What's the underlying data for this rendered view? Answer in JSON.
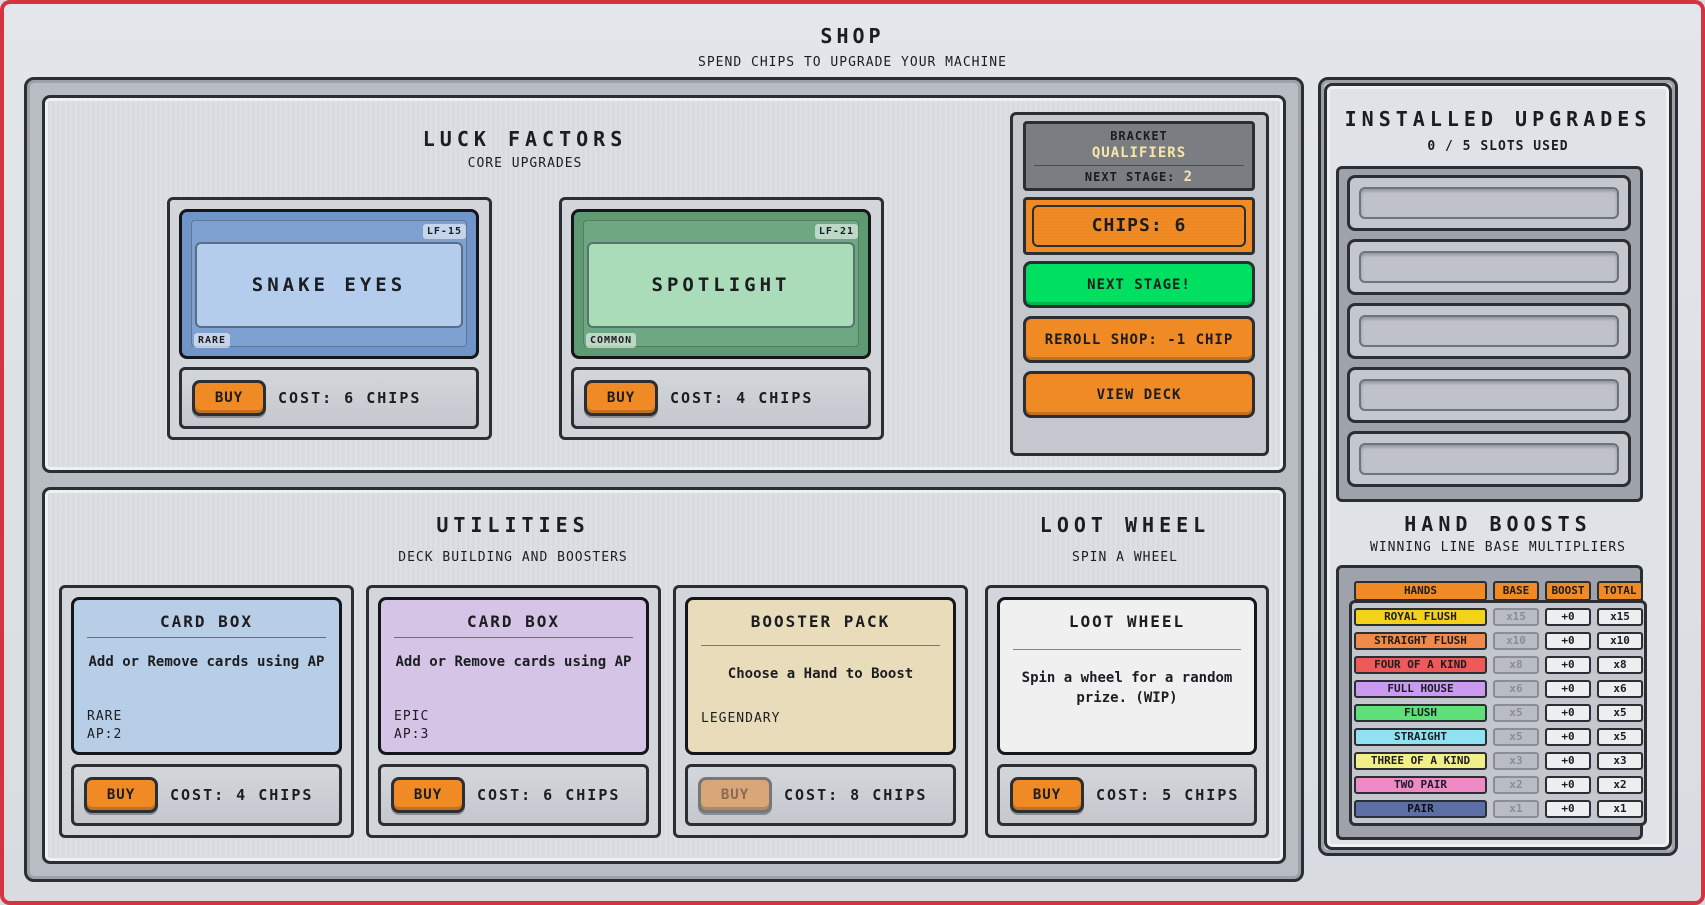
{
  "shop": {
    "title": "SHOP",
    "subtitle": "SPEND CHIPS TO UPGRADE YOUR MACHINE"
  },
  "luck_factors": {
    "title": "LUCK FACTORS",
    "subtitle": "CORE UPGRADES",
    "cards": [
      {
        "name": "SNAKE EYES",
        "code": "LF-15",
        "rarity": "RARE",
        "buy_label": "BUY",
        "cost": "COST: 6 CHIPS",
        "color": "#6f95c9"
      },
      {
        "name": "SPOTLIGHT",
        "code": "LF-21",
        "rarity": "COMMON",
        "buy_label": "BUY",
        "cost": "COST: 4 CHIPS",
        "color": "#5f9a73"
      }
    ]
  },
  "controls": {
    "bracket_label": "BRACKET",
    "bracket_value": "QUALIFIERS",
    "next_stage_label": "NEXT STAGE:",
    "next_stage_value": "2",
    "chips": "CHIPS: 6",
    "next_stage_button": "NEXT STAGE!",
    "reroll_button": "REROLL SHOP: -1 CHIP",
    "view_deck_button": "VIEW DECK",
    "colors": {
      "accent": "#f08a24",
      "go": "#00e060"
    }
  },
  "utilities": {
    "title": "UTILITIES",
    "subtitle": "DECK BUILDING AND BOOSTERS",
    "cards": [
      {
        "title": "CARD BOX",
        "desc": "Add or Remove cards using AP",
        "rarity": "RARE",
        "ap": "AP:2",
        "buy_label": "BUY",
        "cost": "COST: 4 CHIPS",
        "color": "#b8cde6"
      },
      {
        "title": "CARD BOX",
        "desc": "Add or Remove cards using AP",
        "rarity": "EPIC",
        "ap": "AP:3",
        "buy_label": "BUY",
        "cost": "COST: 6 CHIPS",
        "color": "#d5c4e6"
      },
      {
        "title": "BOOSTER PACK",
        "desc": "Choose a Hand to Boost",
        "rarity": "LEGENDARY",
        "buy_label": "BUY",
        "cost": "COST: 8 CHIPS",
        "color": "#e8dcba"
      }
    ]
  },
  "loot_wheel": {
    "title": "LOOT WHEEL",
    "subtitle": "SPIN A WHEEL",
    "card": {
      "title": "LOOT WHEEL",
      "desc": "Spin a wheel for a random prize. (WIP)",
      "buy_label": "BUY",
      "cost": "COST: 5 CHIPS",
      "color": "#f0f0f0"
    }
  },
  "installed": {
    "title": "INSTALLED UPGRADES",
    "slots_used": "0 / 5 SLOTS USED"
  },
  "hand_boosts": {
    "title": "HAND BOOSTS",
    "subtitle": "WINNING LINE BASE MULTIPLIERS",
    "headers": [
      "HANDS",
      "BASE",
      "BOOST",
      "TOTAL"
    ],
    "rows": [
      {
        "hand": "ROYAL FLUSH",
        "base": "x15",
        "boost": "+0",
        "total": "x15",
        "color": "#f4d21a"
      },
      {
        "hand": "STRAIGHT FLUSH",
        "base": "x10",
        "boost": "+0",
        "total": "x10",
        "color": "#f08a4a"
      },
      {
        "hand": "FOUR OF A KIND",
        "base": "x8",
        "boost": "+0",
        "total": "x8",
        "color": "#ee5a5a"
      },
      {
        "hand": "FULL HOUSE",
        "base": "x6",
        "boost": "+0",
        "total": "x6",
        "color": "#c99af0"
      },
      {
        "hand": "FLUSH",
        "base": "x5",
        "boost": "+0",
        "total": "x5",
        "color": "#5fe07a"
      },
      {
        "hand": "STRAIGHT",
        "base": "x5",
        "boost": "+0",
        "total": "x5",
        "color": "#8fe2f2"
      },
      {
        "hand": "THREE OF A KIND",
        "base": "x3",
        "boost": "+0",
        "total": "x3",
        "color": "#f2ef8a"
      },
      {
        "hand": "TWO PAIR",
        "base": "x2",
        "boost": "+0",
        "total": "x2",
        "color": "#f08ac6"
      },
      {
        "hand": "PAIR",
        "base": "x1",
        "boost": "+0",
        "total": "x1",
        "color": "#5c6ea6"
      }
    ]
  }
}
